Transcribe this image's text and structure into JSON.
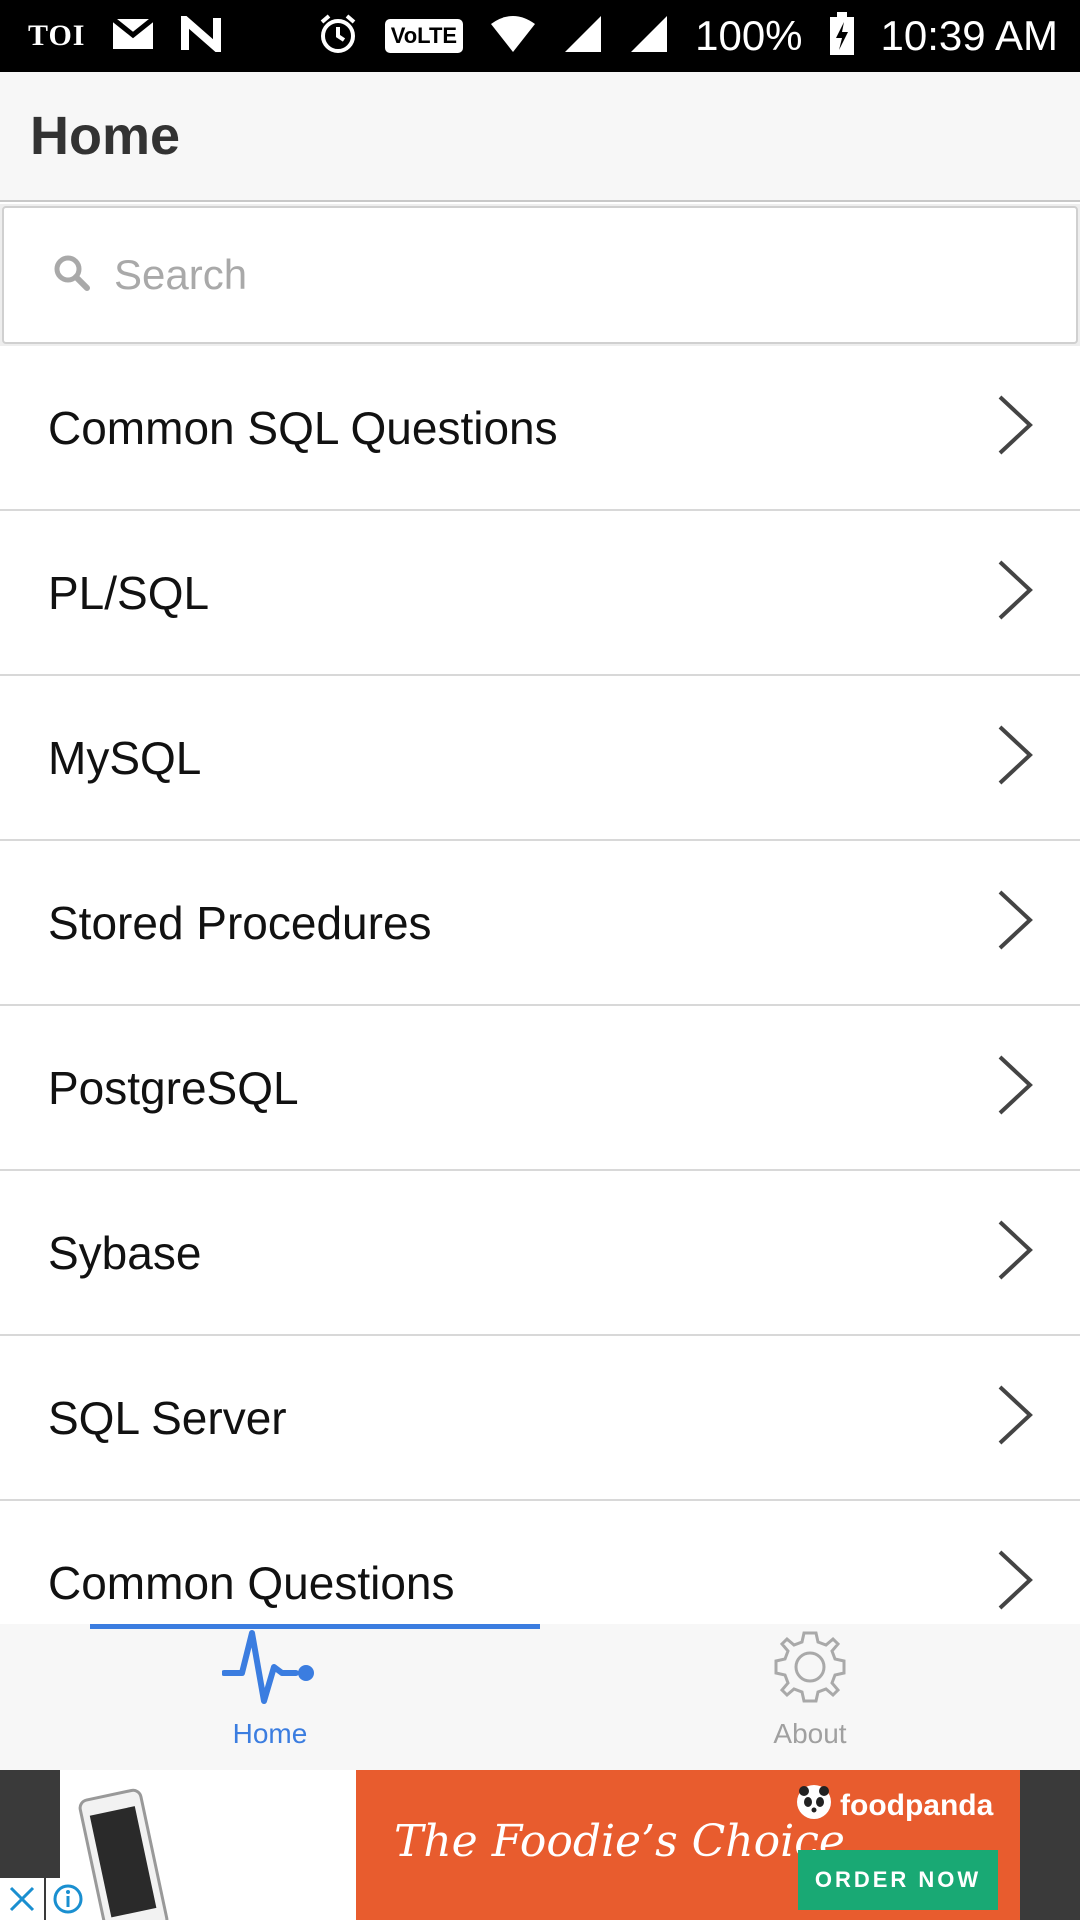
{
  "status_bar": {
    "carrier_label": "TOI",
    "volte_label": "VoLTE",
    "battery_percent": "100%",
    "time": "10:39 AM",
    "icons": [
      "gmail-icon",
      "n-app-icon",
      "alarm-icon",
      "wifi-icon",
      "signal-icon",
      "signal-icon-2",
      "battery-charging-icon"
    ]
  },
  "header": {
    "title": "Home"
  },
  "search": {
    "placeholder": "Search",
    "value": ""
  },
  "list": {
    "items": [
      {
        "label": "Common SQL Questions"
      },
      {
        "label": "PL/SQL"
      },
      {
        "label": "MySQL"
      },
      {
        "label": "Stored Procedures"
      },
      {
        "label": "PostgreSQL"
      },
      {
        "label": "Sybase"
      },
      {
        "label": "SQL Server"
      },
      {
        "label": "Common Questions"
      }
    ]
  },
  "tabs": [
    {
      "label": "Home",
      "icon": "pulse-icon",
      "active": true
    },
    {
      "label": "About",
      "icon": "gear-icon",
      "active": false
    }
  ],
  "ad": {
    "tagline": "The Foodie’s Choice",
    "brand": "foodpanda",
    "cta": "ORDER NOW"
  },
  "colors": {
    "accent": "#3b7de0",
    "ad_orange": "#e85c2e",
    "ad_green": "#19a974"
  }
}
